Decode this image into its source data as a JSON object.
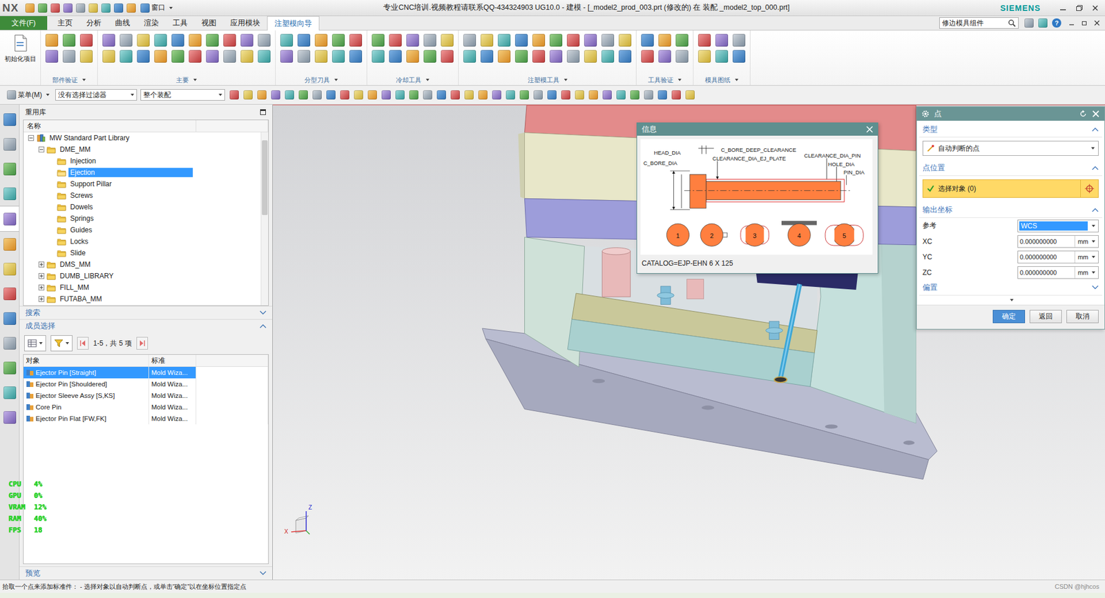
{
  "title_bar": {
    "logo": "NX",
    "window_menu": "窗口",
    "title": "专业CNC培训.视频教程请联系QQ-434324903 UG10.0 - 建模 - [_model2_prod_003.prt (修改的) 在 装配 _model2_top_000.prt]",
    "brand": "SIEMENS"
  },
  "tabs": [
    {
      "label": "文件(F)",
      "kind": "file",
      "selected": false
    },
    {
      "label": "主页",
      "kind": "tab",
      "selected": false
    },
    {
      "label": "分析",
      "kind": "tab",
      "selected": false
    },
    {
      "label": "曲线",
      "kind": "tab",
      "selected": false
    },
    {
      "label": "渲染",
      "kind": "tab",
      "selected": false
    },
    {
      "label": "工具",
      "kind": "tab",
      "selected": false
    },
    {
      "label": "视图",
      "kind": "tab",
      "selected": false
    },
    {
      "label": "应用模块",
      "kind": "tab",
      "selected": false
    },
    {
      "label": "注塑模向导",
      "kind": "tab",
      "selected": true
    }
  ],
  "command_search": {
    "value": "修边模具组件"
  },
  "help": "?",
  "ribbon": {
    "init_button": "初始化项目",
    "groups": [
      {
        "label": "部件验证"
      },
      {
        "label": "主要"
      },
      {
        "label": "分型刀具"
      },
      {
        "label": "冷却工具"
      },
      {
        "label": "注塑模工具"
      },
      {
        "label": "工具验证"
      },
      {
        "label": "模具图纸"
      }
    ]
  },
  "toolbar": {
    "menu": "菜单(M)",
    "selection_filter": "没有选择过滤器",
    "scope": "整个装配"
  },
  "resource_bar": [
    {
      "selected": false
    },
    {
      "selected": false
    },
    {
      "selected": false
    },
    {
      "selected": false
    },
    {
      "selected": true
    },
    {
      "selected": false
    },
    {
      "selected": false
    },
    {
      "selected": false
    },
    {
      "selected": false
    },
    {
      "selected": false
    },
    {
      "selected": false
    },
    {
      "selected": false
    },
    {
      "selected": false
    }
  ],
  "reuse_library": {
    "title": "重用库",
    "tree_column": "名称",
    "tree": [
      {
        "label": "MW Standard Part Library",
        "level": 0,
        "expandable": true,
        "expanded": true,
        "selected": false,
        "kind": "library"
      },
      {
        "label": "DME_MM",
        "level": 1,
        "expandable": true,
        "expanded": true,
        "selected": false,
        "kind": "folder"
      },
      {
        "label": "Injection",
        "level": 2,
        "expandable": false,
        "expanded": false,
        "selected": false,
        "kind": "folder"
      },
      {
        "label": "Ejection",
        "level": 2,
        "expandable": false,
        "expanded": false,
        "selected": true,
        "kind": "folder"
      },
      {
        "label": "Support Pillar",
        "level": 2,
        "expandable": false,
        "expanded": false,
        "selected": false,
        "kind": "folder"
      },
      {
        "label": "Screws",
        "level": 2,
        "expandable": false,
        "expanded": false,
        "selected": false,
        "kind": "folder"
      },
      {
        "label": "Dowels",
        "level": 2,
        "expandable": false,
        "expanded": false,
        "selected": false,
        "kind": "folder"
      },
      {
        "label": "Springs",
        "level": 2,
        "expandable": false,
        "expanded": false,
        "selected": false,
        "kind": "folder"
      },
      {
        "label": "Guides",
        "level": 2,
        "expandable": false,
        "expanded": false,
        "selected": false,
        "kind": "folder"
      },
      {
        "label": "Locks",
        "level": 2,
        "expandable": false,
        "expanded": false,
        "selected": false,
        "kind": "folder"
      },
      {
        "label": "Slide",
        "level": 2,
        "expandable": false,
        "expanded": false,
        "selected": false,
        "kind": "folder"
      },
      {
        "label": "DMS_MM",
        "level": 1,
        "expandable": true,
        "expanded": false,
        "selected": false,
        "kind": "folder"
      },
      {
        "label": "DUMB_LIBRARY",
        "level": 1,
        "expandable": true,
        "expanded": false,
        "selected": false,
        "kind": "folder"
      },
      {
        "label": "FILL_MM",
        "level": 1,
        "expandable": true,
        "expanded": false,
        "selected": false,
        "kind": "folder"
      },
      {
        "label": "FUTABA_MM",
        "level": 1,
        "expandable": true,
        "expanded": false,
        "selected": false,
        "kind": "folder"
      }
    ],
    "search_section": {
      "label": "搜索",
      "expanded": false
    },
    "member_section": {
      "label": "成员选择",
      "expanded": true
    },
    "pager": "1-5，共 5 项",
    "columns": [
      "对象",
      "标准"
    ],
    "members": [
      {
        "object": "Ejector Pin [Straight]",
        "standard": "Mold Wiza...",
        "selected": true
      },
      {
        "object": "Ejector Pin [Shouldered]",
        "standard": "Mold Wiza...",
        "selected": false
      },
      {
        "object": "Ejector Sleeve Assy [S,KS]",
        "standard": "Mold Wiza...",
        "selected": false
      },
      {
        "object": "Core Pin",
        "standard": "Mold Wiza...",
        "selected": false
      },
      {
        "object": "Ejector Pin Flat [FW,FK]",
        "standard": "Mold Wiza...",
        "selected": false
      }
    ],
    "preview_section": {
      "label": "预览",
      "expanded": false
    }
  },
  "performance": [
    {
      "label": "CPU",
      "value": "4%"
    },
    {
      "label": "GPU",
      "value": "0%"
    },
    {
      "label": "VRAM",
      "value": "12%"
    },
    {
      "label": "RAM",
      "value": "40%"
    },
    {
      "label": "FPS",
      "value": "18"
    }
  ],
  "info_dialog": {
    "title": "信息",
    "labels": [
      "HEAD_DIA",
      "C_BORE_DIA",
      "C_BORE_DEEP_CLEARANCE",
      "CLEARANCE_DIA_EJ_PLATE",
      "CLEARANCE_DIA_PIN",
      "HOLE_DIA",
      "PIN_DIA"
    ],
    "sections": [
      {
        "number": "1",
        "kind": "round"
      },
      {
        "number": "2",
        "kind": "key"
      },
      {
        "number": "3",
        "kind": "flat"
      },
      {
        "number": "4",
        "kind": "bar"
      },
      {
        "number": "5",
        "kind": "wide"
      }
    ],
    "catalog": "CATALOG=EJP-EHN 6 X 125"
  },
  "point_dialog": {
    "title": "点",
    "type_section": {
      "label": "类型",
      "expanded": true,
      "value": "自动判断的点"
    },
    "location_section": {
      "label": "点位置",
      "expanded": true,
      "select_label": "选择对象 (0)",
      "satisfied": true
    },
    "output_section": {
      "label": "输出坐标",
      "expanded": true,
      "reference_label": "参考",
      "reference": "WCS",
      "coordinates": [
        {
          "label": "XC",
          "value": "0.000000000",
          "unit": "mm"
        },
        {
          "label": "YC",
          "value": "0.000000000",
          "unit": "mm"
        },
        {
          "label": "ZC",
          "value": "0.000000000",
          "unit": "mm"
        }
      ]
    },
    "offset_section": {
      "label": "偏置",
      "expanded": false
    },
    "buttons": [
      {
        "label": "确定",
        "primary": true
      },
      {
        "label": "返回",
        "primary": false
      },
      {
        "label": "取消",
        "primary": false
      }
    ]
  },
  "triad": {
    "x": "X",
    "z": "Z"
  },
  "status_bar": {
    "prompt": "拾取一个点来添加标准件： - 选择对象以自动判断点，或单击“确定”以在坐标位置指定点",
    "watermark": "CSDN @hjhcos"
  }
}
